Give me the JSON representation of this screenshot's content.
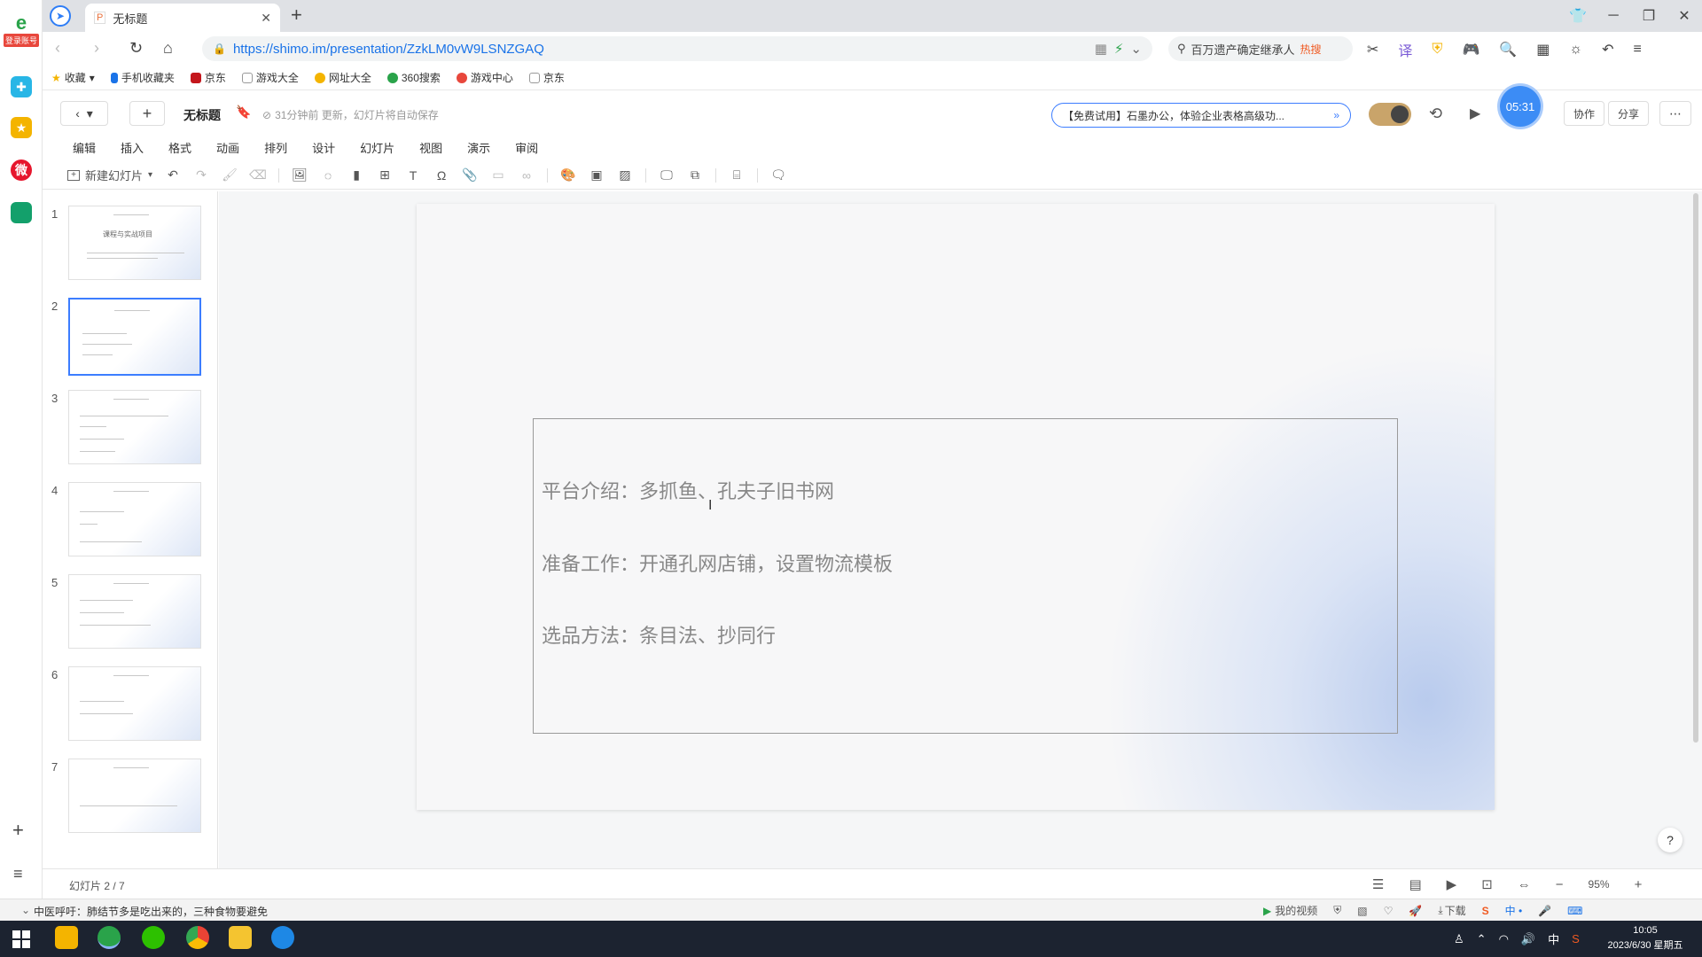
{
  "sidebar": {
    "login_badge": "登录账号",
    "add_label": "+",
    "menu_label": "≡"
  },
  "browser": {
    "tab_title": "无标题",
    "tab_favicon": "P",
    "url": "https://shimo.im/presentation/ZzkLM0vW9LSNZGAQ",
    "search_placeholder": "百万遗产确定继承人",
    "search_badge": "热搜",
    "bookmarks": [
      "收藏",
      "手机收藏夹",
      "京东",
      "游戏大全",
      "网址大全",
      "360搜索",
      "游戏中心",
      "京东"
    ]
  },
  "app": {
    "doc_title": "无标题",
    "save_status": "31分钟前 更新，幻灯片将自动保存",
    "promo": "【免费试用】石墨办公，体验企业表格高级功...",
    "timer": "05:31",
    "collab_label": "协作",
    "share_label": "分享",
    "menu": [
      "编辑",
      "插入",
      "格式",
      "动画",
      "排列",
      "设计",
      "幻灯片",
      "视图",
      "演示",
      "审阅"
    ],
    "new_slide_label": "新建幻灯片"
  },
  "thumbnails": {
    "numbers": [
      "1",
      "2",
      "3",
      "4",
      "5",
      "6",
      "7"
    ],
    "slide1_title": "课程与实战项目"
  },
  "slide": {
    "lines": [
      "平台介绍：多抓鱼、孔夫子旧书网",
      "准备工作：开通孔网店铺，设置物流模板",
      "选品方法：条目法、抄同行"
    ]
  },
  "status": {
    "slide_counter": "幻灯片 2 / 7",
    "zoom": "95%",
    "help": "?"
  },
  "newsbar": {
    "text": "中医呼吁：肺结节多是吃出来的，三种食物要避免",
    "my_video": "我的视频",
    "download": "下载"
  },
  "taskbar": {
    "time": "10:05",
    "date": "2023/6/30 星期五",
    "ime": "中"
  },
  "colors": {
    "accent": "#3c7dff",
    "taskbar": "#1c2330",
    "tab_bar": "#dfe1e5"
  }
}
